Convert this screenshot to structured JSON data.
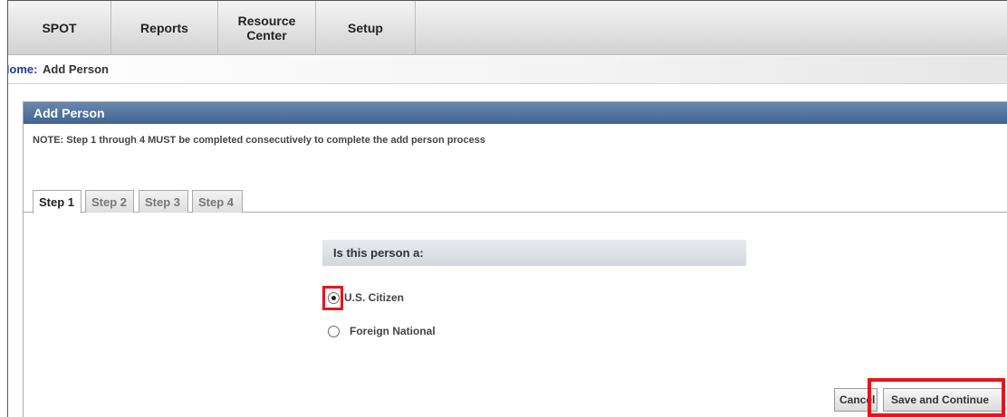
{
  "nav": {
    "items": [
      {
        "label": "SPOT"
      },
      {
        "label": "Reports"
      },
      {
        "label": "Resource Center"
      },
      {
        "label": "Setup"
      }
    ]
  },
  "breadcrumb": {
    "home": "Home:",
    "current": "Add Person"
  },
  "panel": {
    "title": "Add Person",
    "note": "NOTE: Step 1 through 4 MUST be completed consecutively to complete the add person process",
    "tabs": [
      {
        "label": "Step 1",
        "active": true
      },
      {
        "label": "Step 2",
        "active": false
      },
      {
        "label": "Step 3",
        "active": false
      },
      {
        "label": "Step 4",
        "active": false
      }
    ],
    "question": "Is this person a:",
    "options": [
      {
        "label": "U.S. Citizen",
        "selected": true
      },
      {
        "label": "Foreign National",
        "selected": false
      }
    ],
    "buttons": {
      "cancel": "Cancel",
      "save": "Save and Continue"
    }
  },
  "colors": {
    "header_blue": "#3f6393",
    "highlight_red": "#e8141c",
    "link_blue": "#1d3d8a"
  }
}
